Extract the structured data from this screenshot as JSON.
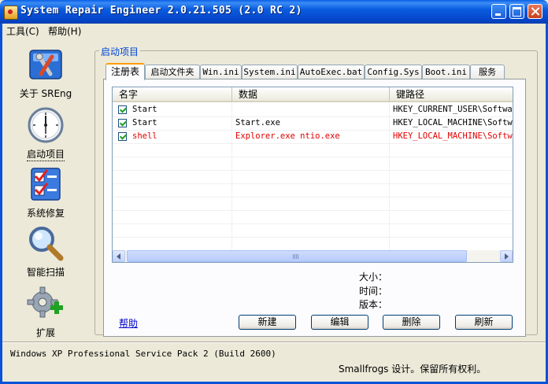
{
  "window": {
    "title": "System Repair Engineer 2.0.21.505 (2.0 RC 2)"
  },
  "menu": {
    "tools": "工具(C)",
    "help": "帮助(H)"
  },
  "nav": {
    "about": "关于 SREng",
    "startup": "启动项目",
    "repair": "系统修复",
    "scan": "智能扫描",
    "extend": "扩展"
  },
  "group_title": "启动项目",
  "tabs": [
    "注册表",
    "启动文件夹",
    "Win.ini",
    "System.ini",
    "AutoExec.bat",
    "Config.Sys",
    "Boot.ini",
    "服务"
  ],
  "list": {
    "columns": [
      "名字",
      "数据",
      "键路径"
    ],
    "rows": [
      {
        "name": "Start",
        "data": "",
        "path": "HKEY_CURRENT_USER\\Softwar",
        "checked": true,
        "highlight": false
      },
      {
        "name": "Start",
        "data": "Start.exe",
        "path": "HKEY_LOCAL_MACHINE\\Softwa",
        "checked": true,
        "highlight": false
      },
      {
        "name": "shell",
        "data": "Explorer.exe ntio.exe",
        "path": "HKEY_LOCAL_MACHINE\\Softwa",
        "checked": true,
        "highlight": true
      }
    ]
  },
  "info": {
    "size_label": "大小：",
    "time_label": "时间：",
    "version_label": "版本："
  },
  "buttons": {
    "help_link": "帮助",
    "new": "新建",
    "edit": "编辑",
    "delete": "删除",
    "refresh": "刷新"
  },
  "status": {
    "os": "Windows XP Professional Service Pack 2 (Build 2600)",
    "copyright": "Smallfrogs 设计。保留所有权利。"
  },
  "colors": {
    "highlight_text": "#e00000",
    "title_bar": "#0a5ce0",
    "group_title": "#0046d5"
  }
}
